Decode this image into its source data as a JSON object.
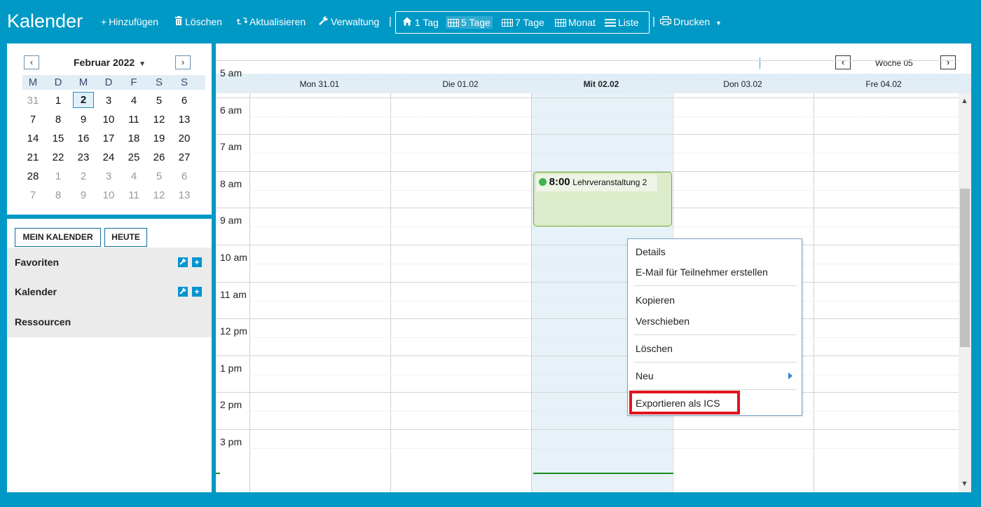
{
  "toolbar": {
    "title": "Kalender",
    "add_label": "Hinzufügen",
    "delete_label": "Löschen",
    "refresh_label": "Aktualisieren",
    "manage_label": "Verwaltung",
    "print_label": "Drucken",
    "views": {
      "day1": "1 Tag",
      "day5": "5 Tage",
      "day7": "7 Tage",
      "month": "Monat",
      "list": "Liste"
    }
  },
  "mini_calendar": {
    "title": "Februar 2022",
    "weekdays": [
      "M",
      "D",
      "M",
      "D",
      "F",
      "S",
      "S"
    ],
    "weeks": [
      [
        "31",
        "1",
        "2",
        "3",
        "4",
        "5",
        "6"
      ],
      [
        "7",
        "8",
        "9",
        "10",
        "11",
        "12",
        "13"
      ],
      [
        "14",
        "15",
        "16",
        "17",
        "18",
        "19",
        "20"
      ],
      [
        "21",
        "22",
        "23",
        "24",
        "25",
        "26",
        "27"
      ],
      [
        "28",
        "1",
        "2",
        "3",
        "4",
        "5",
        "6"
      ],
      [
        "7",
        "8",
        "9",
        "10",
        "11",
        "12",
        "13"
      ]
    ],
    "selected_day": "2"
  },
  "left_panel": {
    "my_calendar_button": "MEIN KALENDER",
    "today_button": "HEUTE",
    "sections": [
      "Favoriten",
      "Kalender",
      "Ressourcen"
    ]
  },
  "main": {
    "week_label": "Woche 05",
    "days": [
      "Mon 31.01",
      "Die 01.02",
      "Mit 02.02",
      "Don 03.02",
      "Fre 04.02"
    ],
    "today_index": 2,
    "hours": [
      "5 am",
      "6 am",
      "7 am",
      "8 am",
      "9 am",
      "10 am",
      "11 am",
      "12 pm",
      "1 pm",
      "2 pm",
      "3 pm"
    ],
    "event": {
      "time": "8:00",
      "title": "Lehrveranstaltung 2",
      "color": "#3fb34f"
    }
  },
  "context_menu": {
    "details": "Details",
    "email": "E-Mail für Teilnehmer erstellen",
    "copy": "Kopieren",
    "move": "Verschieben",
    "delete": "Löschen",
    "new": "Neu",
    "export": "Exportieren als ICS"
  },
  "colors": {
    "accent": "#0099c6",
    "today_column": "#e6f2f8",
    "highlight": "#e0151d"
  }
}
